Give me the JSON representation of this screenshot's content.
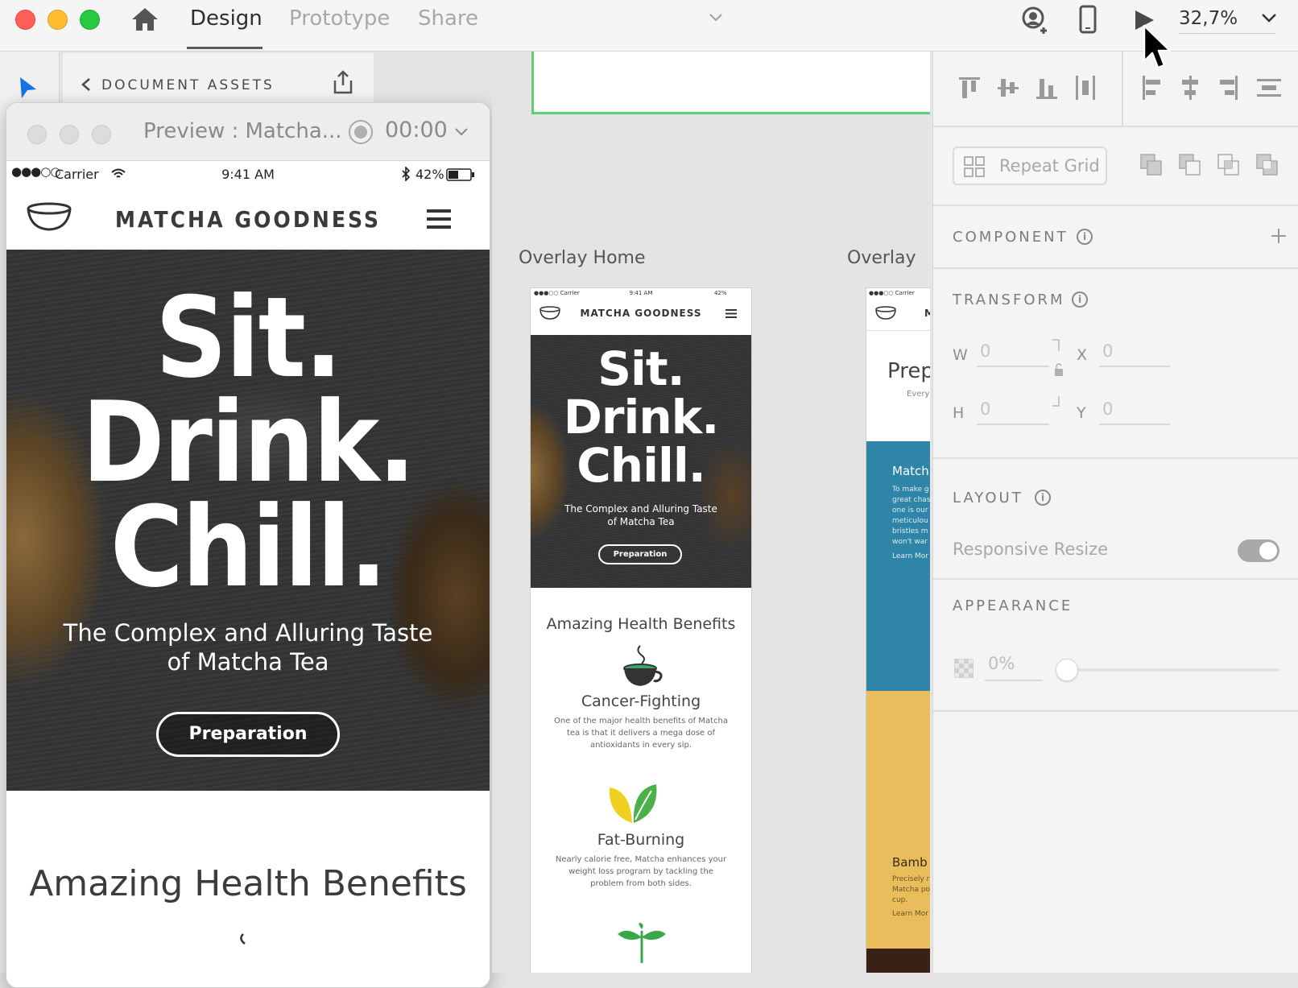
{
  "toolbar": {
    "tabs": [
      {
        "label": "Design",
        "active": true
      },
      {
        "label": "Prototype",
        "active": false
      },
      {
        "label": "Share",
        "active": false
      }
    ],
    "zoom": "32,7%",
    "traffic_colors": [
      "#ff5f57",
      "#febc2e",
      "#28c840"
    ]
  },
  "assets": {
    "title": "DOCUMENT ASSETS"
  },
  "preview": {
    "title": "Preview : Matcha...",
    "time": "00:00",
    "status": {
      "carrier": "Carrier",
      "time": "9:41 AM",
      "battery": "42%"
    },
    "brand": "MATCHA GOODNESS",
    "headline": [
      "Sit.",
      "Drink.",
      "Chill."
    ],
    "subheadline": [
      "The Complex and Alluring Taste",
      "of Matcha Tea"
    ],
    "cta": "Preparation",
    "benefits_title": "Amazing Health Benefits"
  },
  "canvas": {
    "artboard1": {
      "label": "Overlay Home",
      "status": {
        "carrier": "Carrier",
        "time": "9:41 AM",
        "battery": "42%"
      },
      "brand": "MATCHA GOODNESS",
      "headline": [
        "Sit.",
        "Drink.",
        "Chill."
      ],
      "subheadline": [
        "The Complex and Alluring Taste",
        "of Matcha Tea"
      ],
      "cta": "Preparation",
      "benefits_title": "Amazing Health Benefits",
      "benefits": [
        {
          "title": "Cancer-Fighting",
          "text": [
            "One of the major health benefits of Matcha",
            "tea is that it delivers a mega dose of",
            "antioxidants in every sip."
          ]
        },
        {
          "title": "Fat-Burning",
          "text": [
            "Nearly calorie free, Matcha enhances your",
            "weight loss program by tackling the",
            "problem from both sides."
          ]
        }
      ]
    },
    "artboard2": {
      "label": "Overlay",
      "carrier": "Carrier",
      "brand_initial": "M",
      "prep_title": "Prep",
      "prep_sub": "Every",
      "blue_title": "Match",
      "blue_lines": [
        "To make g",
        "great chas",
        "one is our",
        "meticulou",
        "bristles m",
        "won't war"
      ],
      "blue_link": "Learn Mor",
      "yellow_title": "Bamb",
      "yellow_lines": [
        "Precisely r",
        "Matcha po",
        "cup."
      ],
      "yellow_link": "Learn Mor"
    }
  },
  "panel": {
    "repeat_grid": "Repeat Grid",
    "component": {
      "title": "COMPONENT"
    },
    "transform": {
      "title": "TRANSFORM",
      "w_label": "W",
      "w_value": "0",
      "h_label": "H",
      "h_value": "0",
      "x_label": "X",
      "x_value": "0",
      "y_label": "Y",
      "y_value": "0"
    },
    "layout": {
      "title": "LAYOUT",
      "responsive_label": "Responsive Resize",
      "responsive_on": true
    },
    "appearance": {
      "title": "APPEARANCE",
      "opacity": "0%"
    }
  }
}
